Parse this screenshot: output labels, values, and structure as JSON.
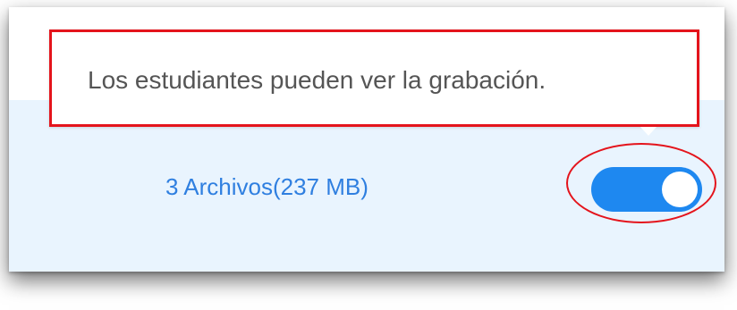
{
  "tooltip": {
    "text": "Los estudiantes pueden ver la grabación."
  },
  "recording_row": {
    "files_link": "3 Archivos(237 MB)",
    "visibility_toggle": {
      "state": "on",
      "accent_color": "#1e88f0"
    }
  },
  "annotations": {
    "highlight_color": "#e4141c"
  },
  "colors": {
    "row_background": "#e9f4fe",
    "link": "#2f7fe0"
  }
}
